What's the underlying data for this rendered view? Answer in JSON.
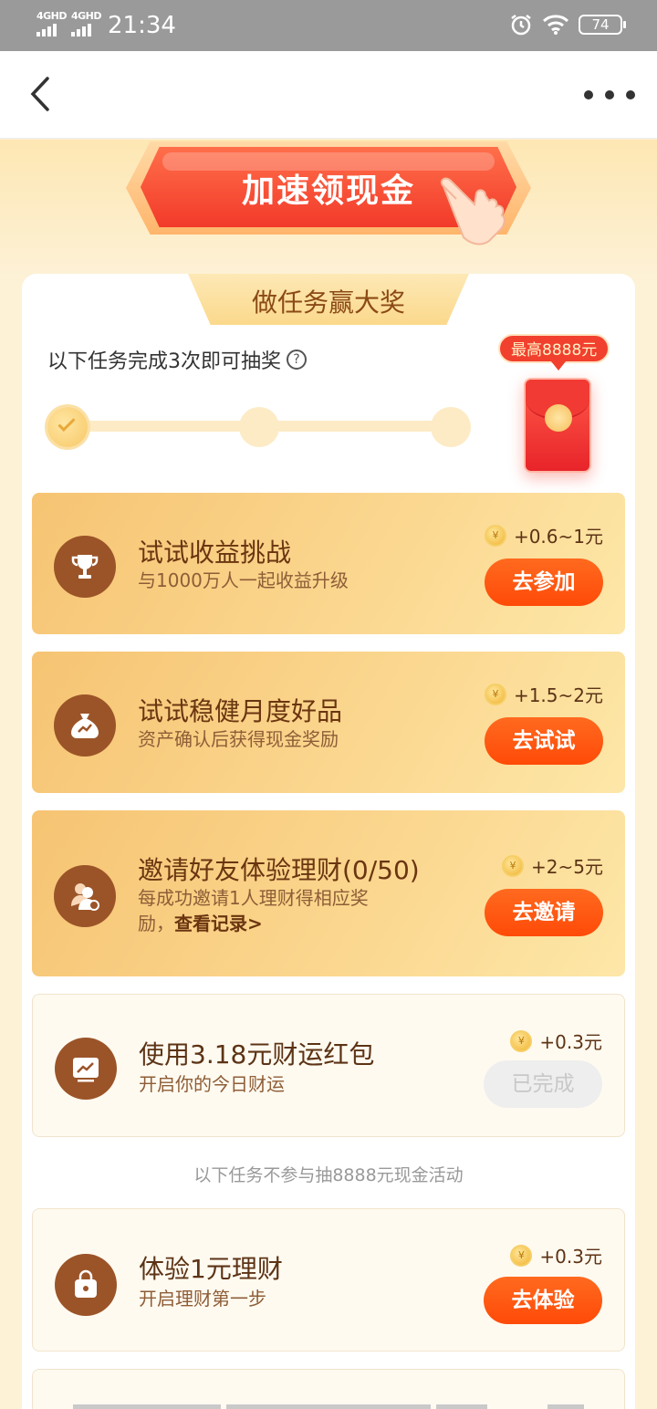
{
  "status_bar": {
    "network_1": "4GHD",
    "network_2": "4GHD",
    "time": "21:34",
    "battery": "74"
  },
  "hero": {
    "button_label": "加速领现金"
  },
  "card": {
    "title": "做任务赢大奖",
    "progress_text": "以下任务完成3次即可抽奖",
    "help_glyph": "?",
    "max_prize_badge": "最高8888元",
    "steps_completed": 1,
    "steps_total": 3
  },
  "tasks": [
    {
      "title": "试试收益挑战",
      "desc": "与1000万人一起收益升级",
      "reward": "+0.6~1元",
      "button": "去参加",
      "icon": "trophy-icon"
    },
    {
      "title": "试试稳健月度好品",
      "desc": "资产确认后获得现金奖励",
      "reward": "+1.5~2元",
      "button": "去试试",
      "icon": "money-bag-icon"
    },
    {
      "title": "邀请好友体验理财(0/50)",
      "desc_line1": "每成功邀请1人理财得相应奖",
      "desc_line2": "励，",
      "desc_link": "查看记录>",
      "reward": "+2~5元",
      "button": "去邀请",
      "icon": "invite-friend-icon"
    },
    {
      "title": "使用3.18元财运红包",
      "desc": "开启你的今日财运",
      "reward": "+0.3元",
      "button": "已完成",
      "icon": "chart-icon"
    }
  ],
  "section_note": "以下任务不参与抽8888元现金活动",
  "extra_tasks": [
    {
      "title": "体验1元理财",
      "desc": "开启理财第一步",
      "reward": "+0.3元",
      "button": "去体验",
      "icon": "lock-bag-icon"
    }
  ],
  "coin_glyph": "¥",
  "colors": {
    "accent_orange": "#ff5a10",
    "brand_brown": "#9b5428",
    "red_packet": "#f2402e"
  }
}
